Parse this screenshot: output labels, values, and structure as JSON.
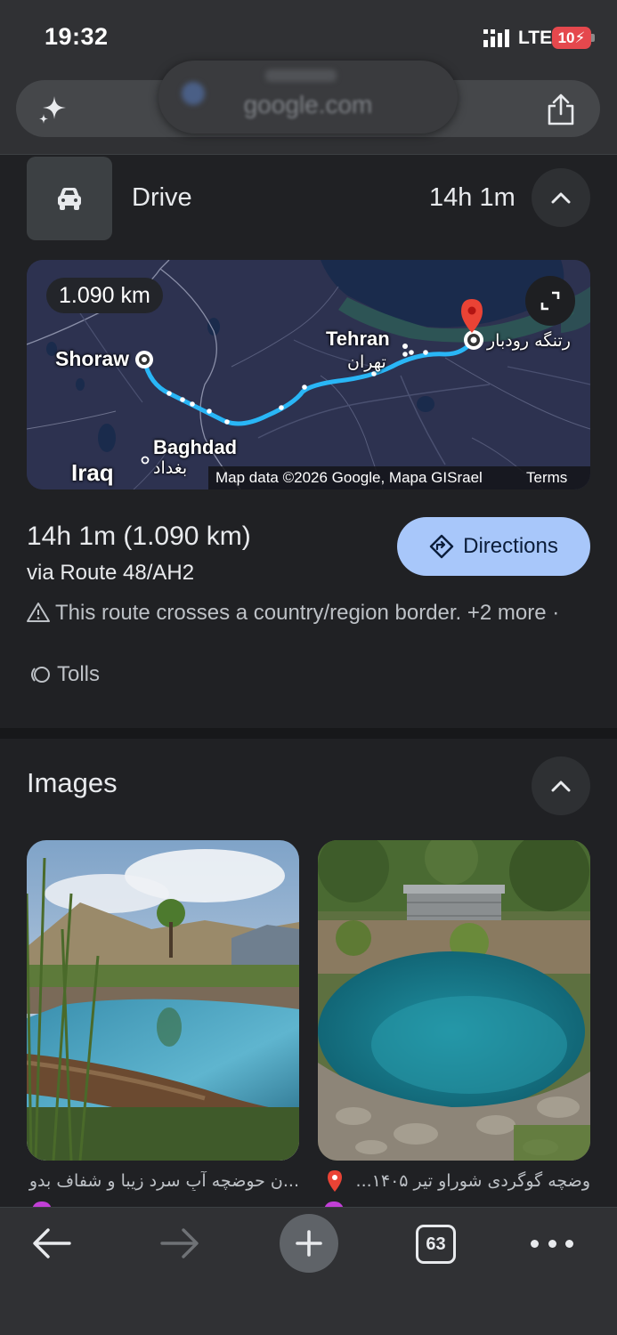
{
  "status_bar": {
    "time": "19:32",
    "network": "LTE",
    "battery": "10"
  },
  "toolbar": {
    "url": "google.com",
    "sparkle_icon": "sparkle-icon",
    "share_icon": "share-icon"
  },
  "drive": {
    "mode_icon": "car-icon",
    "label": "Drive",
    "duration": "14h 1m",
    "map": {
      "distance_chip": "1.090 km",
      "places": {
        "origin": "Shoraw",
        "capital_en": "Tehran",
        "capital_fa": "تهران",
        "destination": "رتنگه رودبار",
        "city_en": "Baghdad",
        "city_ar": "بغداد",
        "country": "Iraq"
      },
      "attribution": "Map data ©2026 Google, Mapa GISrael",
      "terms": "Terms",
      "colors": {
        "route": "#29b6f6",
        "pin": "#ea4335",
        "water": "#1a2b4c"
      }
    },
    "route_title": "14h 1m (1.090 km)",
    "route_via": "via Route 48/AH2",
    "warning_text": "This route crosses a country/region border. +2 more",
    "tolls_text": "Tolls",
    "directions_label": "Directions",
    "accent": "#a8c7fa"
  },
  "images": {
    "header": "Images",
    "items": [
      {
        "caption": "...ن حوضچه آبِ سرد زیبا و شفاف بدو"
      },
      {
        "caption": "وضچه گوگردی شوراو تیر ۱۴۰۵..."
      }
    ]
  },
  "bottom_nav": {
    "tab_count": "63"
  }
}
